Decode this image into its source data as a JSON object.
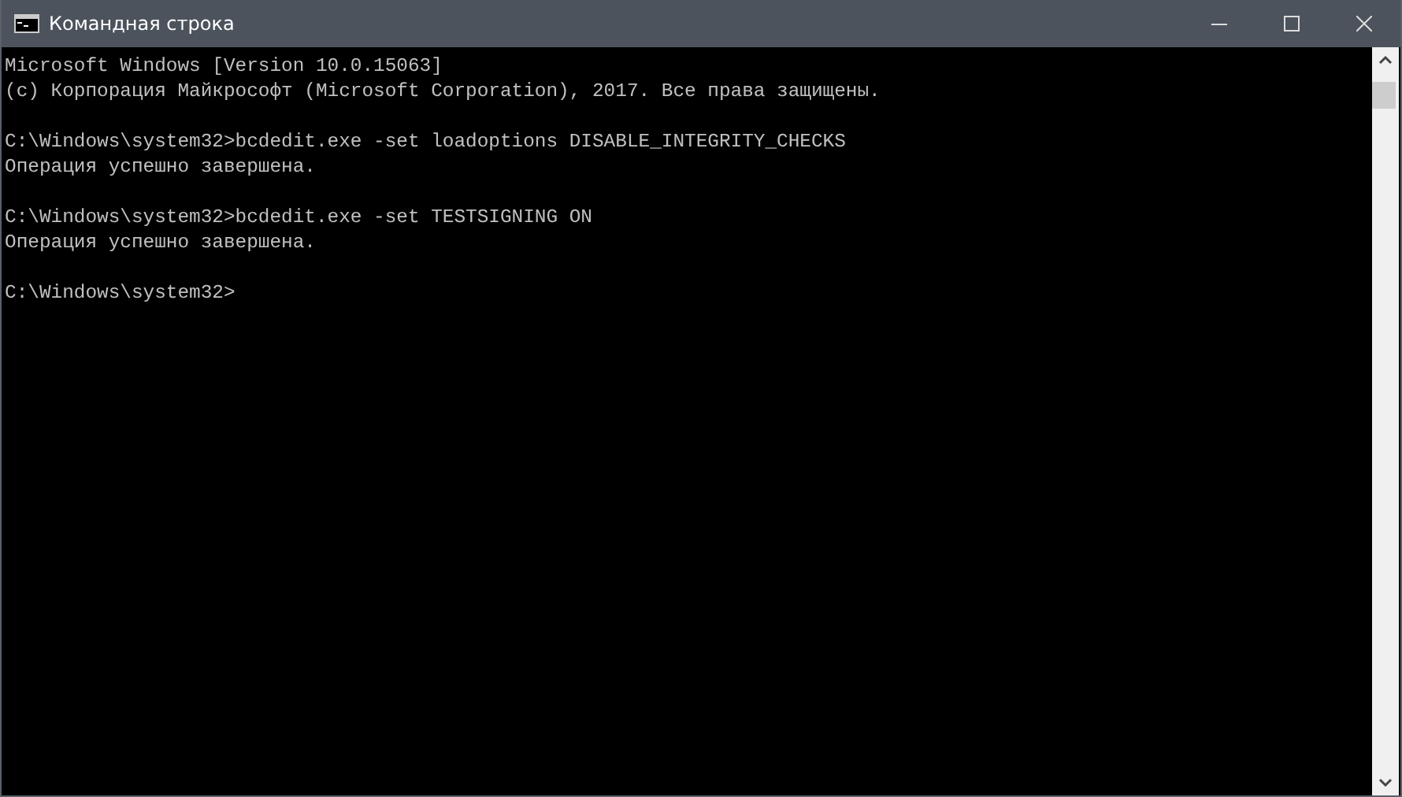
{
  "window": {
    "title": "Командная строка"
  },
  "console": {
    "blocks": [
      [
        "Microsoft Windows [Version 10.0.15063]",
        "(c) Корпорация Майкрософт (Microsoft Corporation), 2017. Все права защищены."
      ],
      [
        "C:\\Windows\\system32>bcdedit.exe -set loadoptions DISABLE_INTEGRITY_CHECKS",
        "Операция успешно завершена."
      ],
      [
        "C:\\Windows\\system32>bcdedit.exe -set TESTSIGNING ON",
        "Операция успешно завершена."
      ],
      [
        "C:\\Windows\\system32>"
      ]
    ]
  }
}
